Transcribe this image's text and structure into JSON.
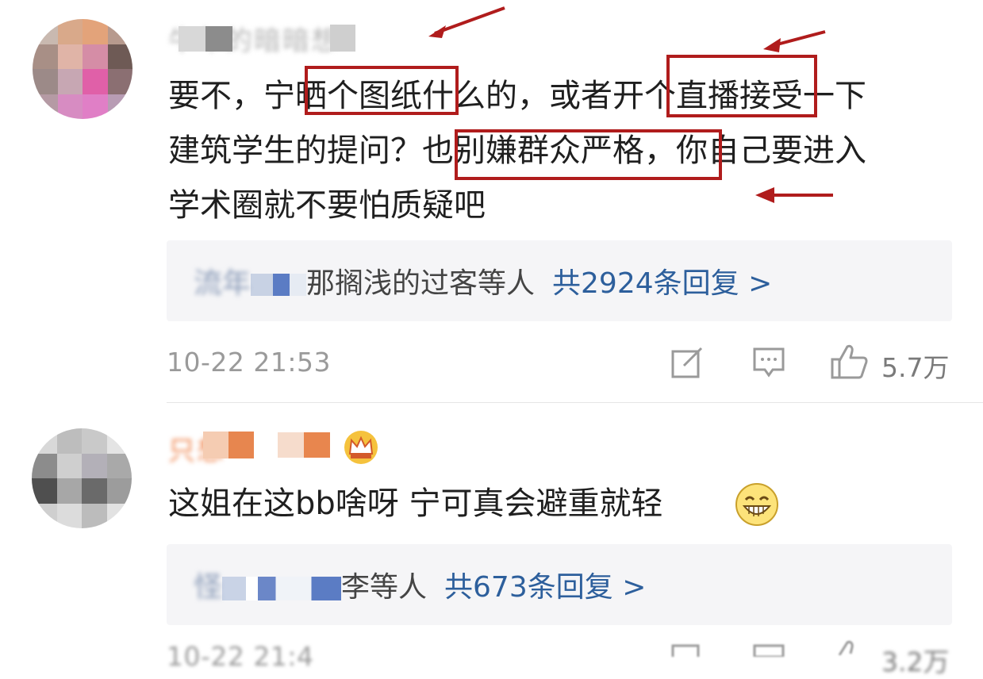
{
  "comments": [
    {
      "username": "牛年的暗暗想",
      "text_lines": [
        "要不，宁晒个图纸什么的，或者开个直播接受一下",
        "建筑学生的提问？也别嫌群众严格，你自己要进入",
        "学术圈就不要怕质疑吧"
      ],
      "reply_names_visible": "那搁浅的过客等人",
      "reply_names_blurred": "流年",
      "reply_count": "共2924条回复 >",
      "time": "10-22 21:53",
      "likes": "5.7万"
    },
    {
      "username": "只想",
      "text": "这姐在这bb啥呀  宁可真会避重就轻",
      "emoji": "grin-emoji",
      "reply_names_visible": "李等人",
      "reply_names_blurred": "怪",
      "reply_count": "共673条回复 >",
      "time": "10-22 21:4",
      "likes": "3.2万"
    }
  ],
  "icons": {
    "edit": "edit-icon",
    "comment": "comment-icon",
    "like": "thumbs-up-icon",
    "badge": "crown-badge-icon"
  },
  "colors": {
    "annotation": "#b01c1c",
    "reply_link": "#2d5f9c",
    "reply_bg": "#f5f5f7",
    "meta": "#9a9a9a"
  }
}
